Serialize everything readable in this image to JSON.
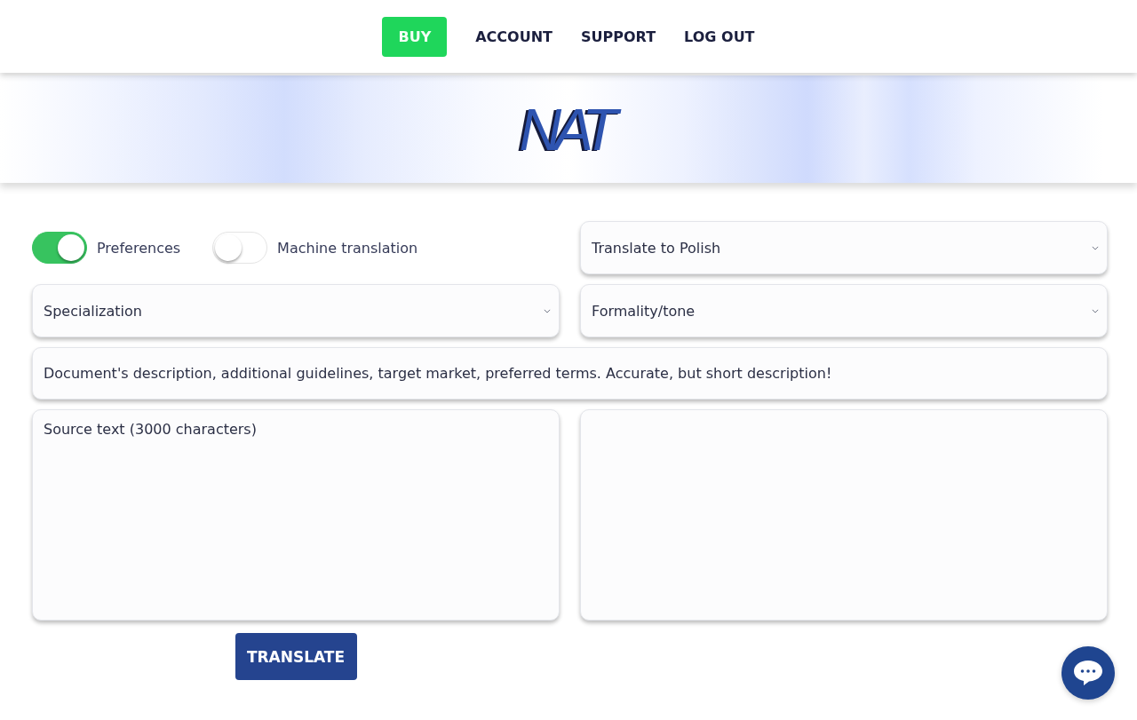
{
  "nav": [
    {
      "label": "BUY",
      "kind": "button"
    },
    {
      "label": "ACCOUNT",
      "kind": "link"
    },
    {
      "label": "SUPPORT",
      "kind": "link"
    },
    {
      "label": "LOG OUT",
      "kind": "link"
    }
  ],
  "banner": {
    "logo": "NAT"
  },
  "toggles": [
    {
      "label": "Preferences",
      "on": true
    },
    {
      "label": "Machine translation",
      "on": false
    }
  ],
  "target_language_select": {
    "value": "Translate to Polish"
  },
  "specialization_select": {
    "value": "Specialization"
  },
  "tone_select": {
    "value": "Formality/tone"
  },
  "description_field": {
    "placeholder": "Document's description, additional guidelines, target market, preferred terms. Accurate, but short description!"
  },
  "source_field": {
    "placeholder": "Source text (3000 characters)"
  },
  "translate_button": {
    "label": "TRANSLATE"
  }
}
